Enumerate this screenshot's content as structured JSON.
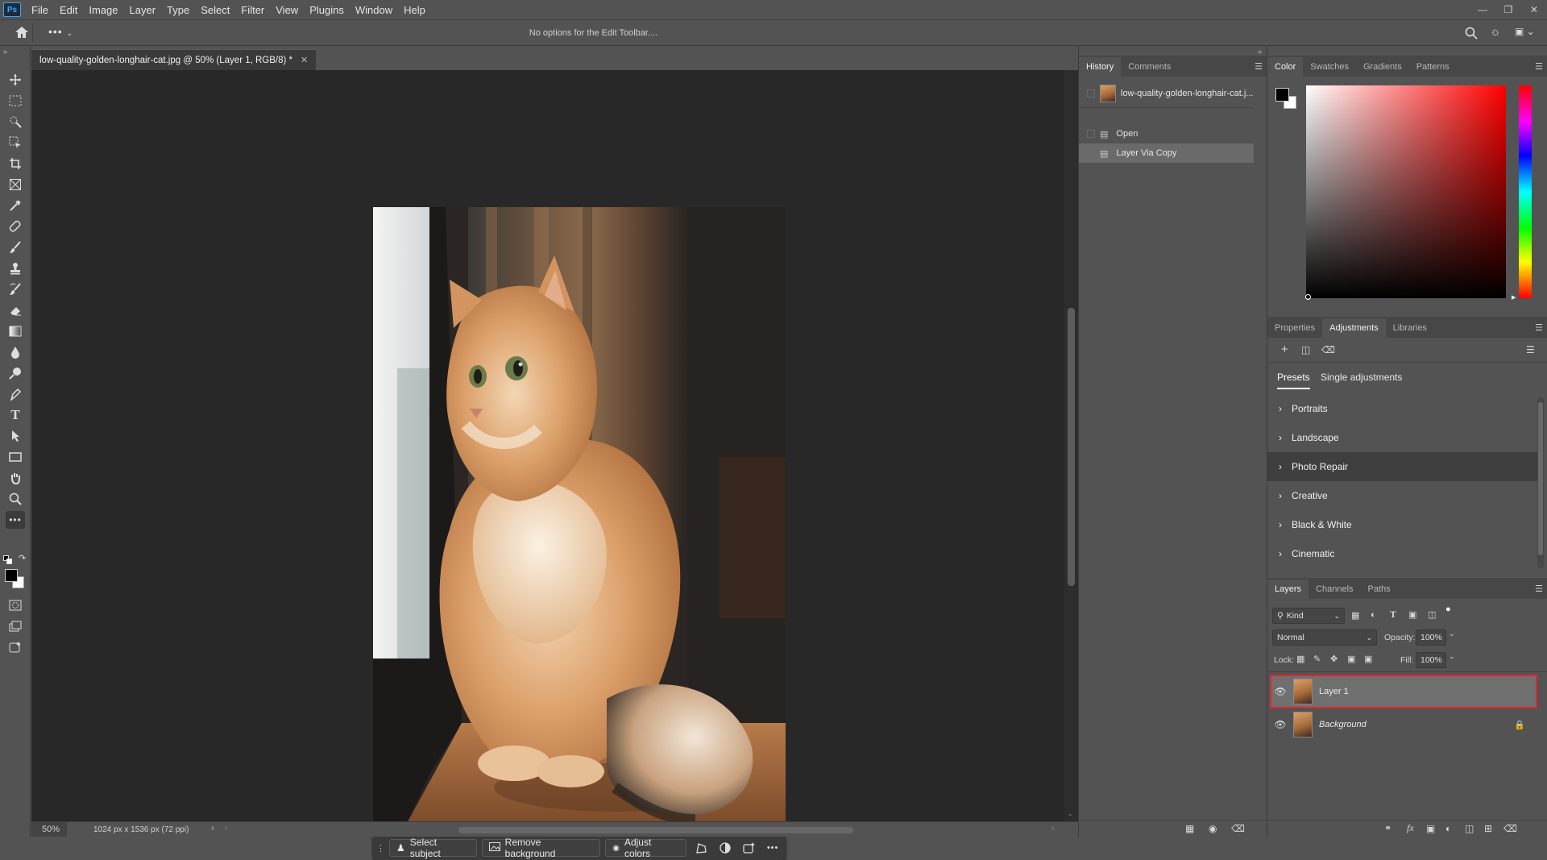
{
  "app": {
    "logo": "Ps"
  },
  "menubar": {
    "items": [
      "File",
      "Edit",
      "Image",
      "Layer",
      "Type",
      "Select",
      "Filter",
      "View",
      "Plugins",
      "Window",
      "Help"
    ]
  },
  "options_bar": {
    "message": "No options for the Edit Toolbar...."
  },
  "document": {
    "tab_title": "low-quality-golden-longhair-cat.jpg @ 50% (Layer 1, RGB/8) *",
    "zoom": "50%",
    "info": "1024 px x 1536 px (72 ppi)"
  },
  "contextual_bar": {
    "select_subject": "Select subject",
    "remove_background": "Remove background",
    "adjust_colors": "Adjust colors"
  },
  "history_panel": {
    "tabs": [
      "History",
      "Comments"
    ],
    "snapshot_label": "low-quality-golden-longhair-cat.j...",
    "states": [
      {
        "label": "Open",
        "selected": false
      },
      {
        "label": "Layer Via Copy",
        "selected": true
      }
    ]
  },
  "color_panel": {
    "tabs": [
      "Color",
      "Swatches",
      "Gradients",
      "Patterns"
    ],
    "hue_base": "#ff0000",
    "foreground": "#000000",
    "background": "#ffffff"
  },
  "adjustments_panel": {
    "tabs": [
      "Properties",
      "Adjustments",
      "Libraries"
    ],
    "subtabs": [
      "Presets",
      "Single adjustments"
    ],
    "presets": [
      "Portraits",
      "Landscape",
      "Photo Repair",
      "Creative",
      "Black & White",
      "Cinematic"
    ],
    "highlighted": "Photo Repair"
  },
  "layers_panel": {
    "tabs": [
      "Layers",
      "Channels",
      "Paths"
    ],
    "filter_kind": "Kind",
    "blend_mode": "Normal",
    "opacity_label": "Opacity:",
    "opacity_value": "100%",
    "lock_label": "Lock:",
    "fill_label": "Fill:",
    "fill_value": "100%",
    "layers": [
      {
        "name": "Layer 1",
        "selected": true
      },
      {
        "name": "Background",
        "selected": false
      }
    ],
    "highlight_color": "#e0262b"
  }
}
